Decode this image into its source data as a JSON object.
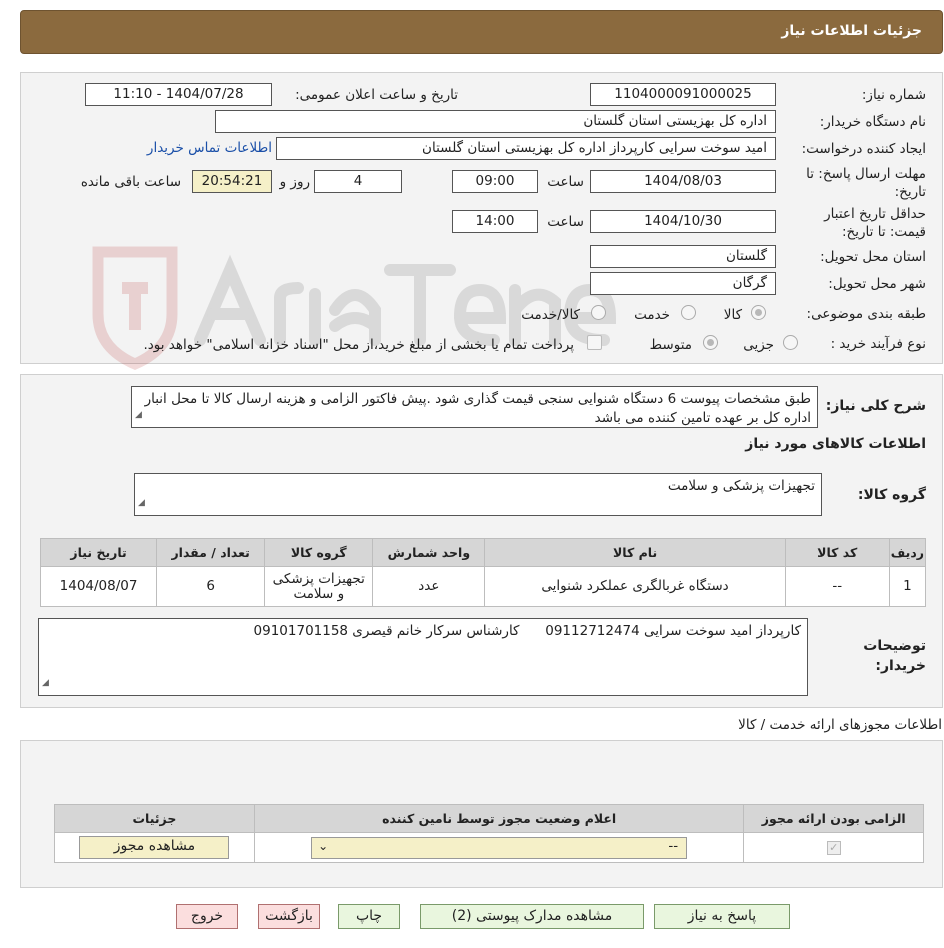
{
  "header": {
    "title": "جزئیات اطلاعات نیاز"
  },
  "info": {
    "need_number_label": "شماره نیاز:",
    "need_number": "1104000091000025",
    "announce_label": "تاریخ و ساعت اعلان عمومی:",
    "announce_value": "1404/07/28 - 11:10",
    "buyer_label": "نام دستگاه خریدار:",
    "buyer_value": "اداره کل بهزیستی استان گلستان",
    "creator_label": "ایجاد کننده درخواست:",
    "creator_value": "امید  سوخت سرایی کارپرداز اداره کل بهزیستی استان گلستان",
    "contact_link": "اطلاعات تماس خریدار",
    "deadline_label_1": "مهلت ارسال پاسخ: تا",
    "deadline_label_2": "تاریخ:",
    "deadline_date": "1404/08/03",
    "time_label": "ساعت",
    "deadline_time": "09:00",
    "days_value": "4",
    "days_label": "روز و",
    "remaining_time": "20:54:21",
    "remaining_label": "ساعت باقی مانده",
    "validity_label_1": "حداقل تاریخ اعتبار",
    "validity_label_2": "قیمت: تا تاریخ:",
    "validity_date": "1404/10/30",
    "validity_time": "14:00",
    "province_label": "استان محل تحویل:",
    "province_value": "گلستان",
    "city_label": "شهر محل تحویل:",
    "city_value": "گرگان",
    "category_label": "طبقه بندی موضوعی:",
    "category_options": [
      "کالا",
      "خدمت",
      "کالا/خدمت"
    ],
    "process_label": "نوع فرآیند خرید :",
    "process_options": [
      "جزیی",
      "متوسط"
    ],
    "process_note": "پرداخت تمام یا بخشی از مبلغ خرید،از محل \"اسناد خزانه اسلامی\" خواهد بود."
  },
  "description": {
    "label": "شرح کلی نیاز:",
    "text": "طبق مشخصات پیوست 6 دستگاه شنوایی سنجی قیمت گذاری شود .پیش فاکتور الزامی و هزینه ارسال کالا تا محل انبار اداره کل بر عهده تامین کننده می باشد",
    "goods_info_title": "اطلاعات کالاهای مورد نیاز",
    "group_label": "گروه کالا:",
    "group_value": "تجهیزات پزشکی و سلامت"
  },
  "goods_table": {
    "headers": [
      "ردیف",
      "کد کالا",
      "نام کالا",
      "واحد شمارش",
      "گروه کالا",
      "تعداد / مقدار",
      "تاریخ نیاز"
    ],
    "rows": [
      [
        "1",
        "--",
        "دستگاه غربالگری عملکرد شنوایی",
        "عدد",
        "تجهیزات پزشکی و سلامت",
        "6",
        "1404/08/07"
      ]
    ]
  },
  "buyer_notes": {
    "label_1": "توضیحات",
    "label_2": "خریدار:",
    "text": "کارپرداز امید سوخت سرایی 09112712474      کارشناس سرکار خانم قیصری 09101701158"
  },
  "permits": {
    "title": "اطلاعات مجوزهای ارائه خدمت / کالا",
    "headers": [
      "الزامی بودن ارائه مجوز",
      "اعلام وضعیت مجوز توسط نامین کننده",
      "جزئیات"
    ],
    "select_value": "--",
    "view_button": "مشاهده مجوز"
  },
  "buttons": {
    "reply": "پاسخ به نیاز",
    "docs": "مشاهده مدارک پیوستی (2)",
    "print": "چاپ",
    "back": "بازگشت",
    "exit": "خروج"
  },
  "colors": {
    "header_bg": "#8b6a3e",
    "link": "#1a4fa8",
    "time_box": "#f5f0c8"
  }
}
